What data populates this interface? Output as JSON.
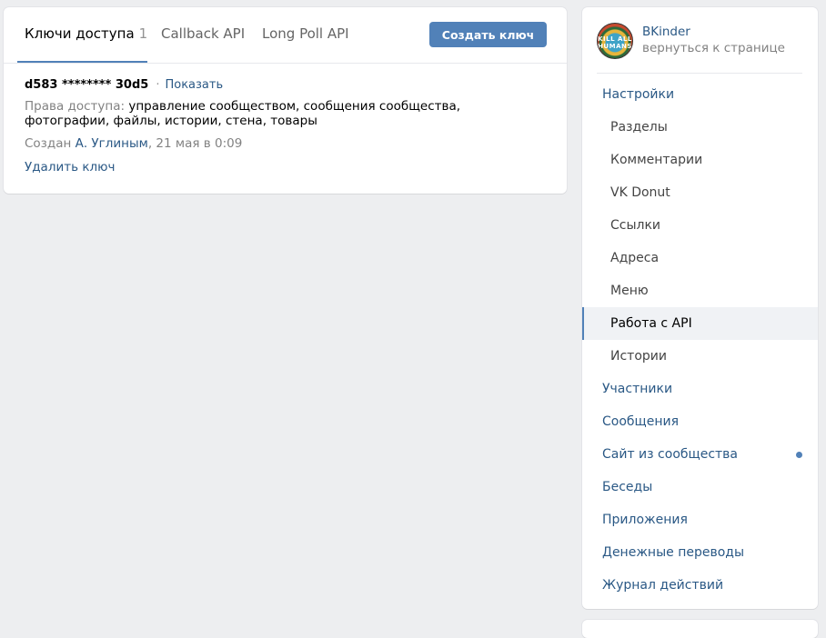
{
  "tabs": [
    {
      "label": "Ключи доступа",
      "count": "1"
    },
    {
      "label": "Callback API"
    },
    {
      "label": "Long Poll API"
    }
  ],
  "create_button": "Создать ключ",
  "key": {
    "masked": "d583 ******** 30d5",
    "separator": "·",
    "show_link": "Показать",
    "rights_label": "Права доступа:",
    "rights_value": "управление сообществом, сообщения сообщества, фотографии, файлы, истории, стена, товары",
    "created_prefix": "Создан",
    "created_by": "А. Углиным",
    "created_date": ", 21 мая в 0:09",
    "delete_link": "Удалить ключ"
  },
  "profile": {
    "name": "BKinder",
    "back_link": "вернуться к странице",
    "avatar_text": "KILL ALL HUMANS"
  },
  "menu": [
    {
      "label": "Настройки",
      "level": "top"
    },
    {
      "label": "Разделы",
      "level": "sub"
    },
    {
      "label": "Комментарии",
      "level": "sub"
    },
    {
      "label": "VK Donut",
      "level": "sub"
    },
    {
      "label": "Ссылки",
      "level": "sub"
    },
    {
      "label": "Адреса",
      "level": "sub"
    },
    {
      "label": "Меню",
      "level": "sub"
    },
    {
      "label": "Работа с API",
      "level": "sub",
      "selected": true
    },
    {
      "label": "Истории",
      "level": "sub"
    },
    {
      "label": "Участники",
      "level": "top"
    },
    {
      "label": "Сообщения",
      "level": "top"
    },
    {
      "label": "Сайт из сообщества",
      "level": "top",
      "indicator": true
    },
    {
      "label": "Беседы",
      "level": "top"
    },
    {
      "label": "Приложения",
      "level": "top"
    },
    {
      "label": "Денежные переводы",
      "level": "top"
    },
    {
      "label": "Журнал действий",
      "level": "top"
    }
  ],
  "colors": {
    "accent": "#5181b8",
    "link": "#2a5885",
    "background": "#edeef0"
  }
}
